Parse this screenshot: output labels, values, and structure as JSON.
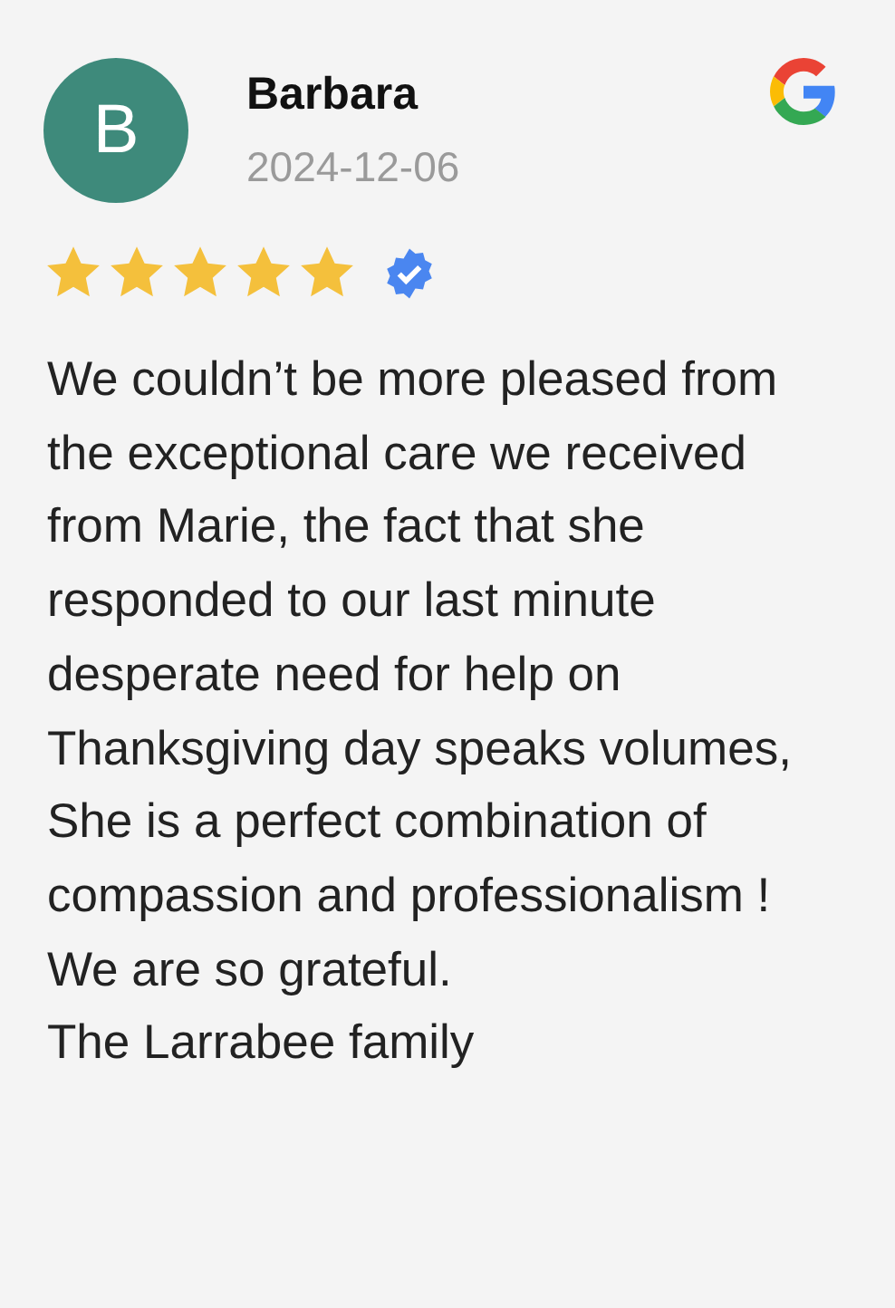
{
  "review": {
    "avatar_letter": "B",
    "name": "Barbara",
    "date": "2024-12-06",
    "stars": 5,
    "verified": true,
    "text": "We couldn’t be more pleased from the exceptional care we received from Marie, the fact that she responded to our last minute desperate need for help on Thanksgiving day speaks volumes,\nShe is a perfect combination of compassion and professionalism !\nWe are so grateful.\nThe Larrabee family"
  }
}
